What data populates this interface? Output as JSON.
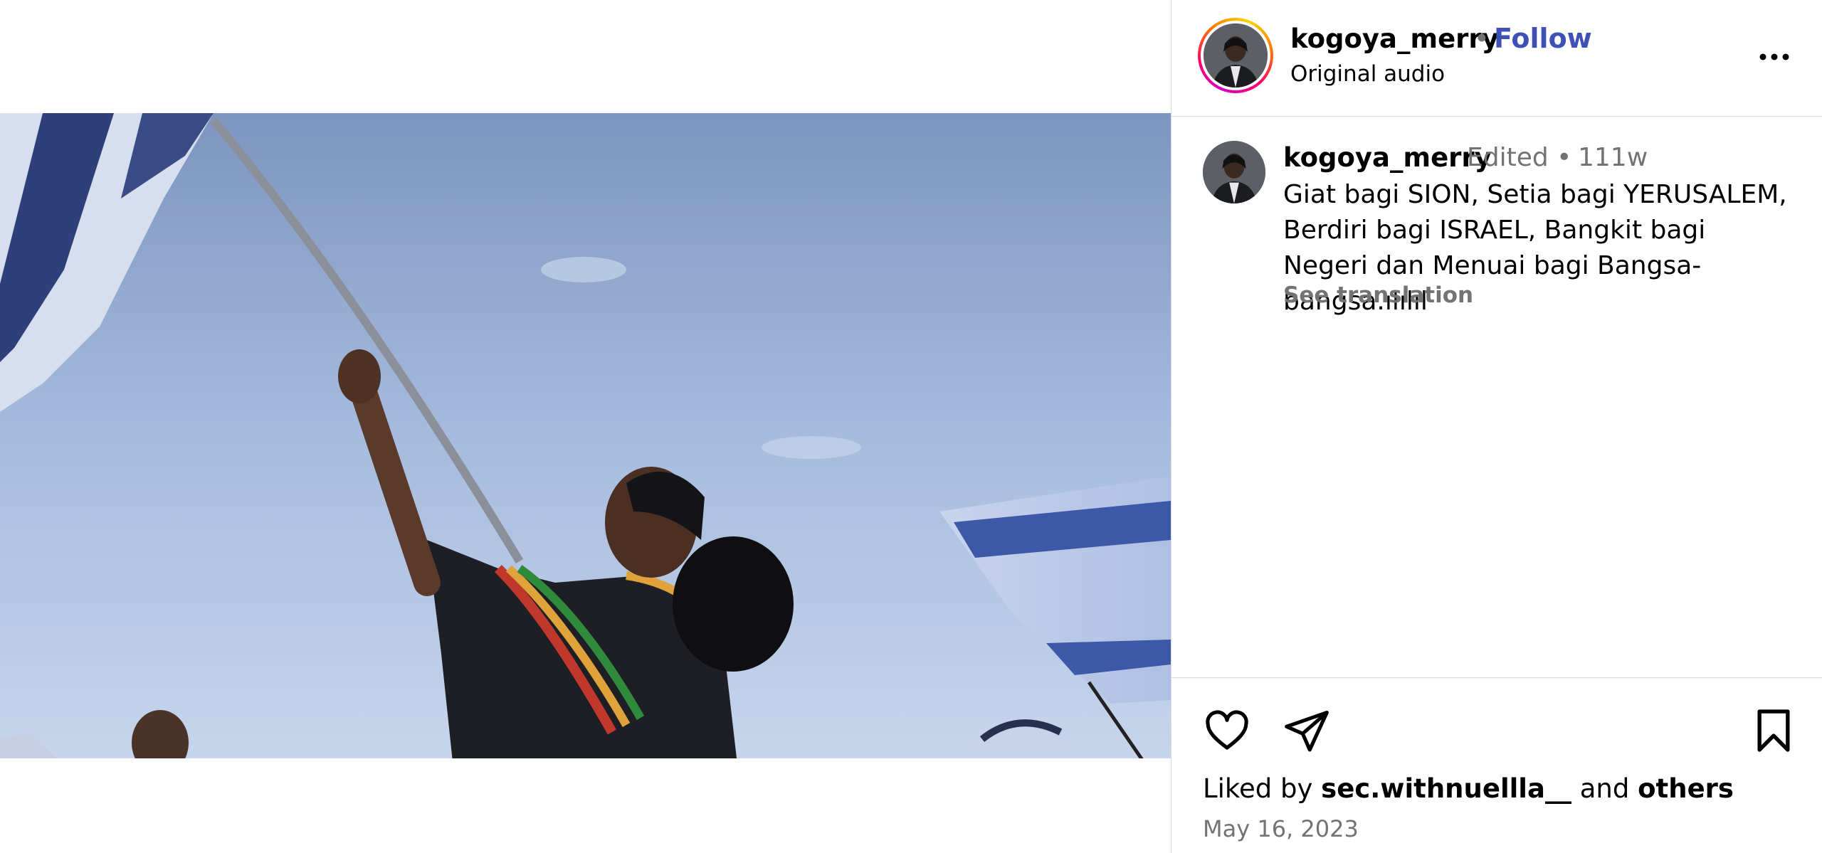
{
  "post": {
    "username": "kogoya_merry",
    "dot": "•",
    "follow_label": "Follow",
    "audio": "Original audio",
    "caption": {
      "username": "kogoya_merry",
      "edited": "Edited •",
      "time": "111w",
      "text": "Giat bagi SION, Setia bagi YERUSALEM, Berdiri bagi ISRAEL, Bangkit bagi Negeri dan Menuai bagi Bangsa-bangsa.ılılıl",
      "see_translation": "See translation"
    },
    "likes": {
      "prefix": "Liked by",
      "user": "sec.withnuellla__",
      "middle": "and",
      "others": "others"
    },
    "date": "May 16, 2023"
  },
  "icons": {
    "tag": "user-tag-icon",
    "mute": "muted-speaker-icon",
    "more": "more-options-icon",
    "like": "heart-icon",
    "share": "paper-plane-icon",
    "save": "bookmark-icon"
  },
  "colors": {
    "follow": "#3f51b5",
    "secondary_text": "#737373",
    "divider": "#dbdbdb"
  }
}
